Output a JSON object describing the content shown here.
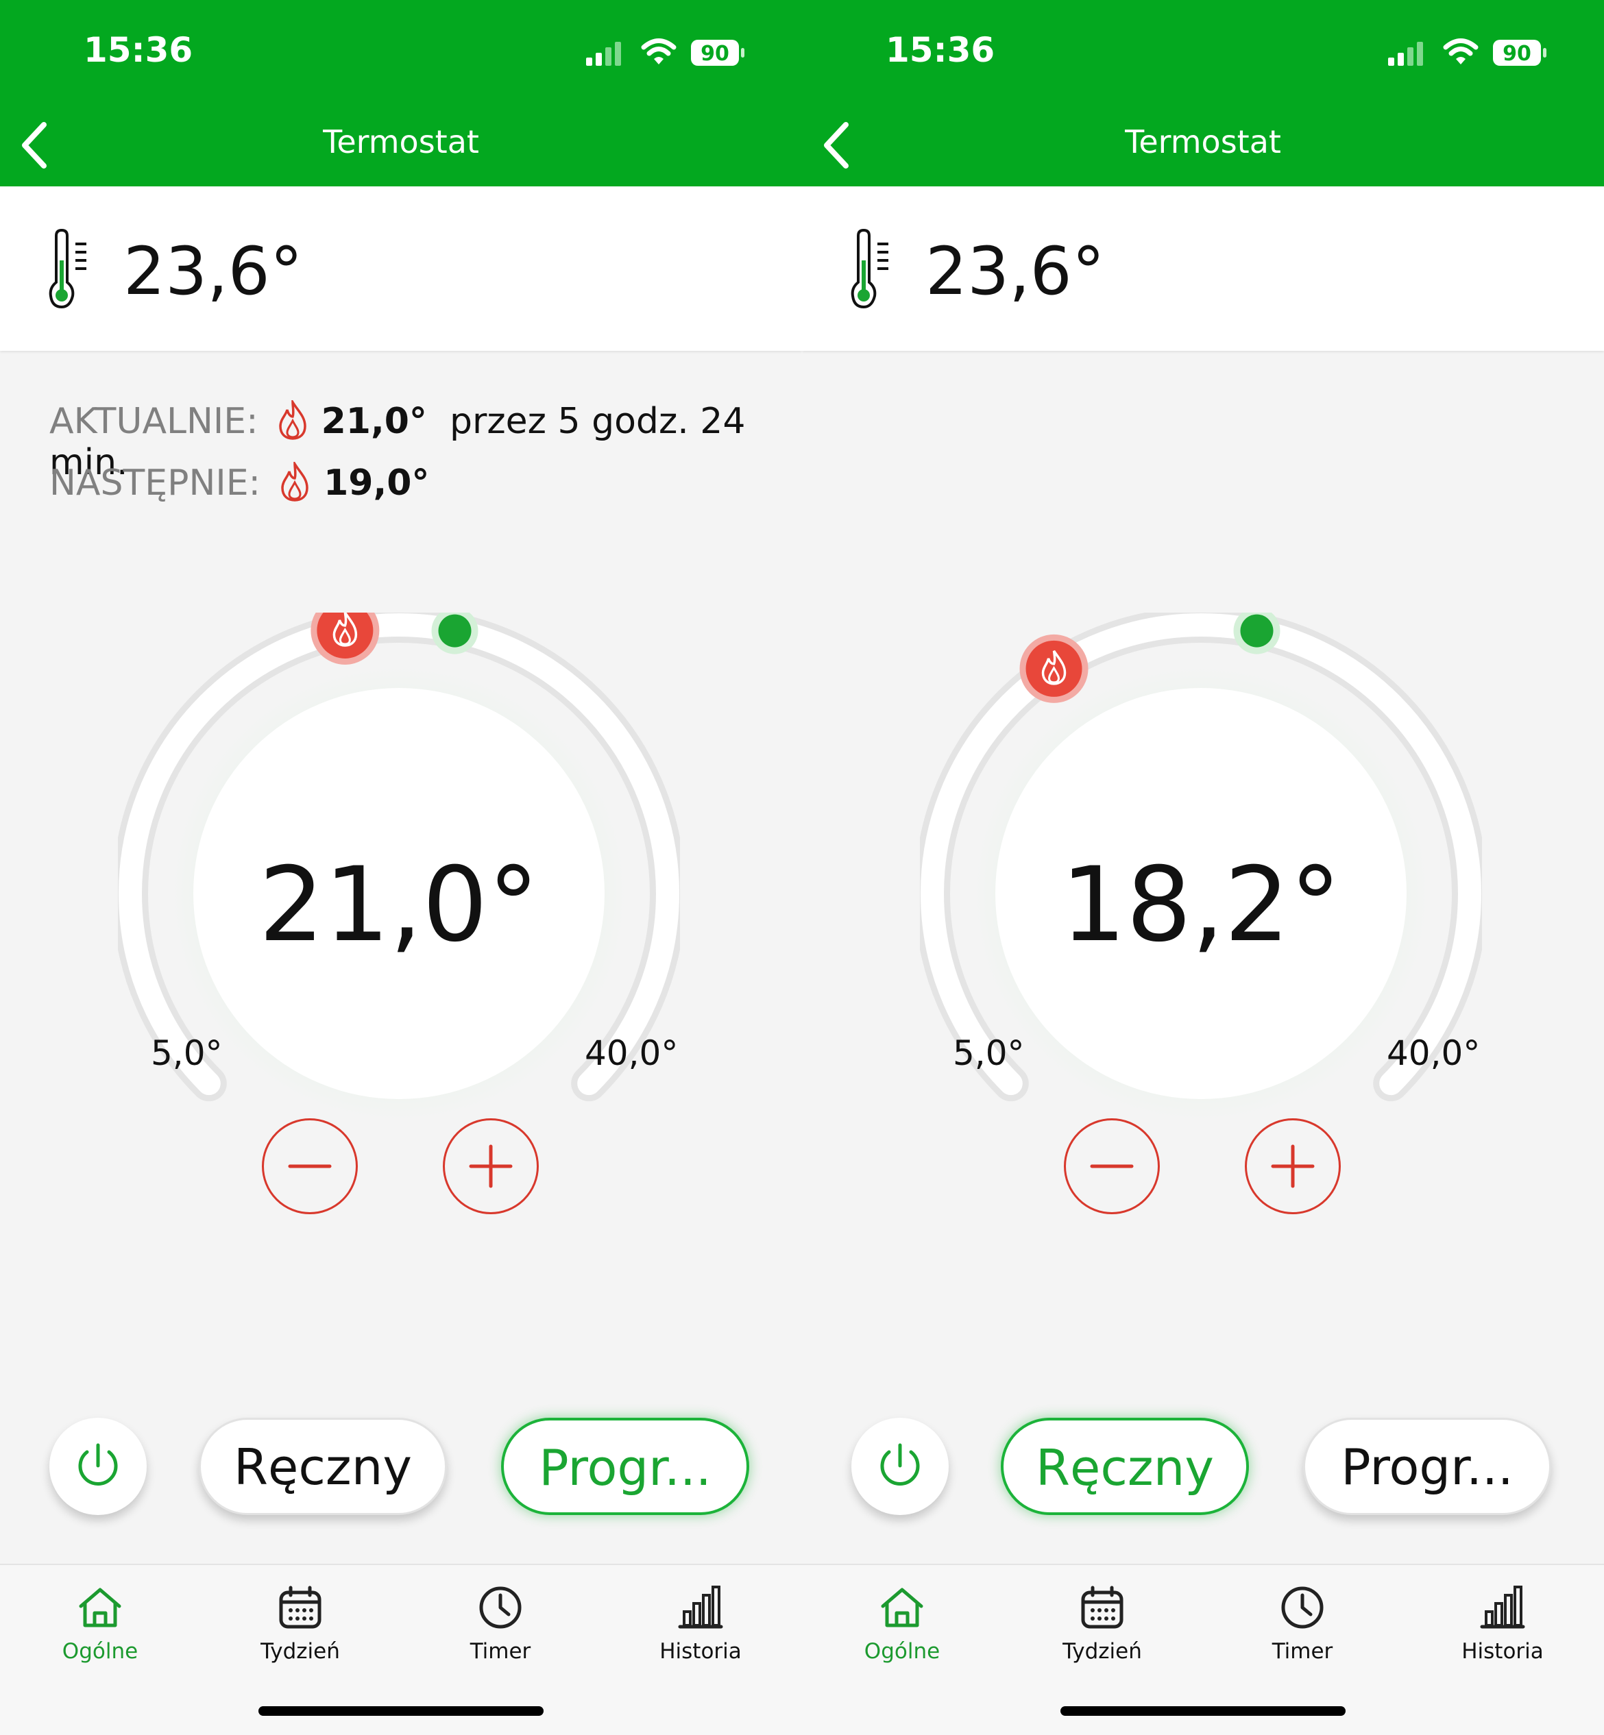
{
  "screens": [
    {
      "status": {
        "time": "15:36",
        "battery": "90"
      },
      "nav": {
        "title": "Termostat"
      },
      "current_temp": "23,6°",
      "info": {
        "now_label": "AKTUALNIE:",
        "now_value": "21,0°",
        "now_duration": "przez 5 godz. 24 min.",
        "next_label": "NASTĘPNIE:",
        "next_value": "19,0°"
      },
      "dial": {
        "value": "21,0°",
        "setpoint": 21.0,
        "min": 5.0,
        "max": 40.0,
        "min_label": "5,0°",
        "max_label": "40,0°"
      },
      "modes": {
        "manual_label": "Ręczny",
        "program_label": "Progr...",
        "active": "program"
      },
      "tabs": [
        {
          "label": "Ogólne",
          "icon": "home-icon",
          "selected": true
        },
        {
          "label": "Tydzień",
          "icon": "calendar-icon",
          "selected": false
        },
        {
          "label": "Timer",
          "icon": "clock-icon",
          "selected": false
        },
        {
          "label": "Historia",
          "icon": "bar-chart-icon",
          "selected": false
        }
      ]
    },
    {
      "status": {
        "time": "15:36",
        "battery": "90"
      },
      "nav": {
        "title": "Termostat"
      },
      "current_temp": "23,6°",
      "dial": {
        "value": "18,2°",
        "setpoint": 18.2,
        "min": 5.0,
        "max": 40.0,
        "min_label": "5,0°",
        "max_label": "40,0°"
      },
      "modes": {
        "manual_label": "Ręczny",
        "program_label": "Progr...",
        "active": "manual"
      },
      "tabs": [
        {
          "label": "Ogólne",
          "icon": "home-icon",
          "selected": true
        },
        {
          "label": "Tydzień",
          "icon": "calendar-icon",
          "selected": false
        },
        {
          "label": "Timer",
          "icon": "clock-icon",
          "selected": false
        },
        {
          "label": "Historia",
          "icon": "bar-chart-icon",
          "selected": false
        }
      ]
    }
  ],
  "colors": {
    "brand_green": "#03a81f",
    "accent_red": "#e8473a",
    "active_green": "#1cb33a"
  }
}
